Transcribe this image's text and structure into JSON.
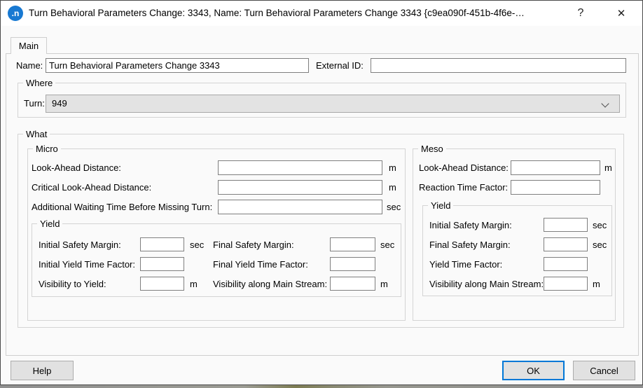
{
  "window": {
    "icon_text": ".n",
    "title": "Turn Behavioral Parameters Change: 3343, Name: Turn Behavioral Parameters Change 3343  {c9ea090f-451b-4f6e-…",
    "help_glyph": "?",
    "close_glyph": "✕"
  },
  "tabs": {
    "main_label": "Main"
  },
  "header": {
    "name_label": "Name:",
    "name_value": "Turn Behavioral Parameters Change 3343",
    "external_id_label": "External ID:",
    "external_id_value": ""
  },
  "where": {
    "title": "Where",
    "turn_label": "Turn:",
    "turn_value": "949"
  },
  "what": {
    "title": "What",
    "micro": {
      "title": "Micro",
      "fields": [
        {
          "label": "Look-Ahead Distance:",
          "value": "",
          "unit": "m"
        },
        {
          "label": "Critical Look-Ahead Distance:",
          "value": "",
          "unit": "m"
        },
        {
          "label": "Additional Waiting Time Before Missing Turn:",
          "value": "",
          "unit": "sec"
        }
      ],
      "yield": {
        "title": "Yield",
        "rows": [
          {
            "left_label": "Initial Safety Margin:",
            "left_value": "",
            "left_unit": "sec",
            "right_label": "Final Safety Margin:",
            "right_value": "",
            "right_unit": "sec"
          },
          {
            "left_label": "Initial Yield Time Factor:",
            "left_value": "",
            "left_unit": "",
            "right_label": "Final Yield Time Factor:",
            "right_value": "",
            "right_unit": ""
          },
          {
            "left_label": "Visibility to Yield:",
            "left_value": "",
            "left_unit": "m",
            "right_label": "Visibility along Main Stream:",
            "right_value": "",
            "right_unit": "m"
          }
        ]
      }
    },
    "meso": {
      "title": "Meso",
      "fields": [
        {
          "label": "Look-Ahead Distance:",
          "value": "",
          "unit": "m"
        },
        {
          "label": "Reaction Time Factor:",
          "value": "",
          "unit": ""
        }
      ],
      "yield": {
        "title": "Yield",
        "fields": [
          {
            "label": "Initial Safety Margin:",
            "value": "",
            "unit": "sec"
          },
          {
            "label": "Final Safety Margin:",
            "value": "",
            "unit": "sec"
          },
          {
            "label": "Yield Time Factor:",
            "value": "",
            "unit": ""
          },
          {
            "label": "Visibility along Main Stream:",
            "value": "",
            "unit": "m"
          }
        ]
      }
    }
  },
  "footer": {
    "help_label": "Help",
    "ok_label": "OK",
    "cancel_label": "Cancel"
  },
  "colors": {
    "accent": "#0078d7",
    "combo_bg": "#e3e3e3",
    "icon_bg": "#1879d2"
  }
}
